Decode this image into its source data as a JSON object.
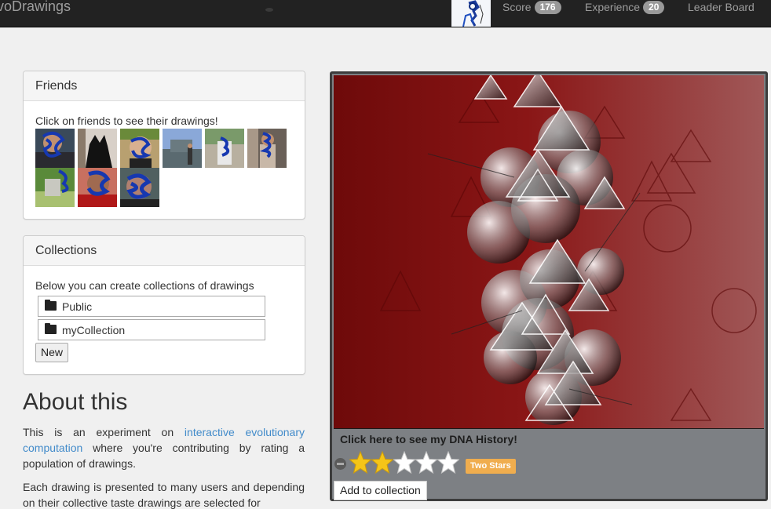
{
  "navbar": {
    "brand": "voDrawings",
    "links": [
      {
        "label": "Score",
        "badge": "176"
      },
      {
        "label": "Experience",
        "badge": "20"
      },
      {
        "label": "Leader Board"
      }
    ]
  },
  "friends": {
    "title": "Friends",
    "hint": "Click on friends to see their drawings!",
    "count": 9
  },
  "collections": {
    "title": "Collections",
    "hint": "Below you can create collections of drawings",
    "items": [
      "Public",
      "myCollection"
    ],
    "new_label": "New"
  },
  "about": {
    "title": "About this",
    "p1_before": "This is an experiment on ",
    "p1_link": "interactive evolutionary computation",
    "p1_after": " where you're contributing by rating a population of drawings.",
    "p2": "Each drawing is presented to many users and depending on their collective taste drawings are selected for"
  },
  "drawing": {
    "dna_link": "Click here to see my DNA History!",
    "rating": 2,
    "max_rating": 5,
    "rating_label": "Two Stars",
    "add_label": "Add to collection"
  },
  "colors": {
    "navbar": "#222222",
    "badge": "#999999",
    "link": "#428bca",
    "star_on": "#f5c518",
    "star_off": "#ffffff",
    "rating_label_bg": "#f0ad4e",
    "canvas_red": "#7a0e0e"
  }
}
